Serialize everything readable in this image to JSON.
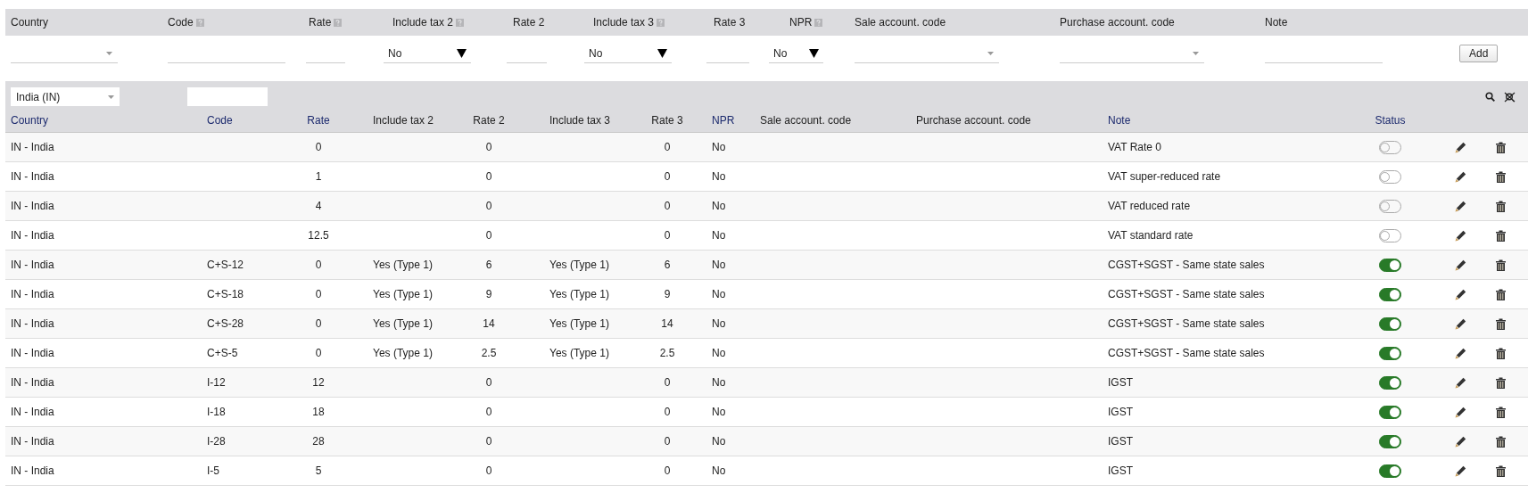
{
  "add_form": {
    "columns": [
      {
        "label": "Country",
        "help": false
      },
      {
        "label": "Code",
        "help": true
      },
      {
        "label": "Rate",
        "help": true
      },
      {
        "label": "Include tax 2",
        "help": true
      },
      {
        "label": "Rate 2",
        "help": false
      },
      {
        "label": "Include tax 3",
        "help": true
      },
      {
        "label": "Rate 3",
        "help": false
      },
      {
        "label": "NPR",
        "help": true
      },
      {
        "label": "Sale account. code",
        "help": false
      },
      {
        "label": "Purchase account. code",
        "help": false
      },
      {
        "label": "Note",
        "help": false
      }
    ],
    "fields": [
      {
        "kind": "combo"
      },
      {
        "kind": "input"
      },
      {
        "kind": "input"
      },
      {
        "kind": "select",
        "value": "No"
      },
      {
        "kind": "input"
      },
      {
        "kind": "select",
        "value": "No"
      },
      {
        "kind": "input"
      },
      {
        "kind": "select",
        "value": "No"
      },
      {
        "kind": "combo"
      },
      {
        "kind": "combo"
      },
      {
        "kind": "input"
      }
    ],
    "add_button": "Add"
  },
  "filter_bar": {
    "country_filter": "India (IN)"
  },
  "table": {
    "columns": [
      {
        "label": "Country",
        "sortable": true
      },
      {
        "label": "Code",
        "sortable": true
      },
      {
        "label": "Rate",
        "sortable": true
      },
      {
        "label": "Include tax 2",
        "sortable": false
      },
      {
        "label": "Rate 2",
        "sortable": false
      },
      {
        "label": "Include tax 3",
        "sortable": false
      },
      {
        "label": "Rate 3",
        "sortable": false
      },
      {
        "label": "NPR",
        "sortable": true
      },
      {
        "label": "Sale account. code",
        "sortable": false
      },
      {
        "label": "Purchase account. code",
        "sortable": false
      },
      {
        "label": "Note",
        "sortable": true
      },
      {
        "label": "Status",
        "sortable": true
      }
    ],
    "rows": [
      {
        "country": "IN - India",
        "code": "",
        "rate": "0",
        "include_tax_2": "",
        "rate_2": "0",
        "include_tax_3": "",
        "rate_3": "0",
        "npr": "No",
        "note": "VAT Rate 0",
        "status_on": false
      },
      {
        "country": "IN - India",
        "code": "",
        "rate": "1",
        "include_tax_2": "",
        "rate_2": "0",
        "include_tax_3": "",
        "rate_3": "0",
        "npr": "No",
        "note": "VAT super-reduced rate",
        "status_on": false
      },
      {
        "country": "IN - India",
        "code": "",
        "rate": "4",
        "include_tax_2": "",
        "rate_2": "0",
        "include_tax_3": "",
        "rate_3": "0",
        "npr": "No",
        "note": "VAT reduced rate",
        "status_on": false
      },
      {
        "country": "IN - India",
        "code": "",
        "rate": "12.5",
        "include_tax_2": "",
        "rate_2": "0",
        "include_tax_3": "",
        "rate_3": "0",
        "npr": "No",
        "note": "VAT standard rate",
        "status_on": false
      },
      {
        "country": "IN - India",
        "code": "C+S-12",
        "rate": "0",
        "include_tax_2": "Yes (Type 1)",
        "rate_2": "6",
        "include_tax_3": "Yes (Type 1)",
        "rate_3": "6",
        "npr": "No",
        "note": "CGST+SGST - Same state sales",
        "status_on": true
      },
      {
        "country": "IN - India",
        "code": "C+S-18",
        "rate": "0",
        "include_tax_2": "Yes (Type 1)",
        "rate_2": "9",
        "include_tax_3": "Yes (Type 1)",
        "rate_3": "9",
        "npr": "No",
        "note": "CGST+SGST - Same state sales",
        "status_on": true
      },
      {
        "country": "IN - India",
        "code": "C+S-28",
        "rate": "0",
        "include_tax_2": "Yes (Type 1)",
        "rate_2": "14",
        "include_tax_3": "Yes (Type 1)",
        "rate_3": "14",
        "npr": "No",
        "note": "CGST+SGST - Same state sales",
        "status_on": true
      },
      {
        "country": "IN - India",
        "code": "C+S-5",
        "rate": "0",
        "include_tax_2": "Yes (Type 1)",
        "rate_2": "2.5",
        "include_tax_3": "Yes (Type 1)",
        "rate_3": "2.5",
        "npr": "No",
        "note": "CGST+SGST - Same state sales",
        "status_on": true
      },
      {
        "country": "IN - India",
        "code": "I-12",
        "rate": "12",
        "include_tax_2": "",
        "rate_2": "0",
        "include_tax_3": "",
        "rate_3": "0",
        "npr": "No",
        "note": "IGST",
        "status_on": true
      },
      {
        "country": "IN - India",
        "code": "I-18",
        "rate": "18",
        "include_tax_2": "",
        "rate_2": "0",
        "include_tax_3": "",
        "rate_3": "0",
        "npr": "No",
        "note": "IGST",
        "status_on": true
      },
      {
        "country": "IN - India",
        "code": "I-28",
        "rate": "28",
        "include_tax_2": "",
        "rate_2": "0",
        "include_tax_3": "",
        "rate_3": "0",
        "npr": "No",
        "note": "IGST",
        "status_on": true
      },
      {
        "country": "IN - India",
        "code": "I-5",
        "rate": "5",
        "include_tax_2": "",
        "rate_2": "0",
        "include_tax_3": "",
        "rate_3": "0",
        "npr": "No",
        "note": "IGST",
        "status_on": true
      }
    ]
  }
}
